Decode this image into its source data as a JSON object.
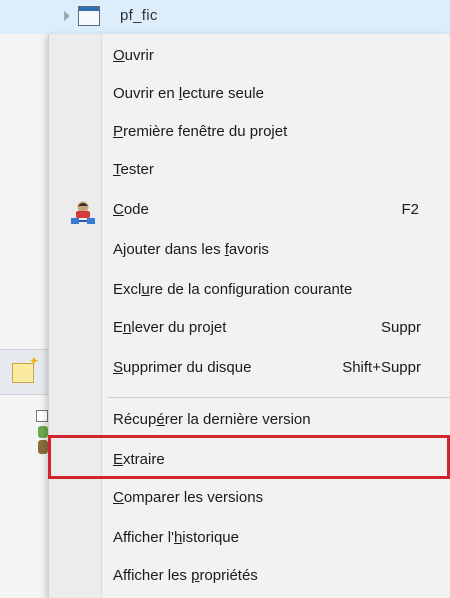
{
  "tree": {
    "item_label": "pf_fic",
    "icons": [
      "expand-arrow-icon",
      "document-icon",
      "folder-icon"
    ]
  },
  "menu": {
    "items": [
      {
        "pre": "",
        "mn": "O",
        "post": "uvrir",
        "shortcut": ""
      },
      {
        "pre": "Ouvrir en ",
        "mn": "l",
        "post": "ecture seule",
        "shortcut": ""
      },
      {
        "pre": "",
        "mn": "P",
        "post": "remière fenêtre du projet",
        "shortcut": ""
      },
      {
        "pre": "",
        "mn": "T",
        "post": "ester",
        "shortcut": ""
      },
      {
        "pre": "",
        "mn": "C",
        "post": "ode",
        "shortcut": "F2",
        "icon": "code-icon"
      },
      {
        "pre": "Ajouter dans les ",
        "mn": "f",
        "post": "avoris",
        "shortcut": ""
      },
      {
        "pre": "Excl",
        "mn": "u",
        "post": "re de la configuration courante",
        "shortcut": ""
      },
      {
        "pre": "E",
        "mn": "n",
        "post": "lever du projet",
        "shortcut": "Suppr"
      },
      {
        "pre": "",
        "mn": "S",
        "post": "upprimer du disque",
        "shortcut": "Shift+Suppr"
      },
      {
        "pre": "Récup",
        "mn": "é",
        "post": "rer la dernière version",
        "shortcut": ""
      },
      {
        "pre": "",
        "mn": "E",
        "post": "xtraire",
        "shortcut": ""
      },
      {
        "pre": "",
        "mn": "C",
        "post": "omparer les versions",
        "shortcut": ""
      },
      {
        "pre": "Afficher l'",
        "mn": "h",
        "post": "istorique",
        "shortcut": ""
      },
      {
        "pre": "Afficher les ",
        "mn": "p",
        "post": "ropriétés",
        "shortcut": ""
      }
    ]
  },
  "colors": {
    "highlight_border": "#d1242f",
    "selection_row": "#dceefb",
    "menu_background": "#f2f2f2"
  }
}
